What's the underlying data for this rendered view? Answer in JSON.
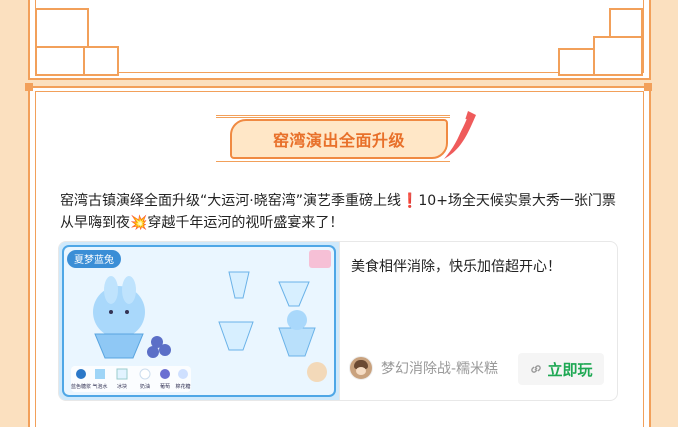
{
  "banner": {
    "title": "窑湾演出全面升级"
  },
  "article": {
    "paragraph": "窑湾古镇演绎全面升级“大运河·晓窑湾”演艺季重磅上线❗10+场全天候实景大秀一张门票从早嗨到夜💥穿越千年运河的视听盛宴来了！"
  },
  "card": {
    "description": "美食相伴消除，快乐加倍超开心！",
    "game_name": "梦幻消除战-糯米糕",
    "play_label": "立即玩",
    "thumb_title": "夏梦蓝兔",
    "thumb_legend": [
      "蓝色糖浆",
      "气泡水",
      "冰块",
      "奶油",
      "葡萄",
      "棉花糖"
    ],
    "colors": {
      "accent": "#f2a05a",
      "banner_text": "#e8702a",
      "play_green": "#1ea853"
    }
  }
}
